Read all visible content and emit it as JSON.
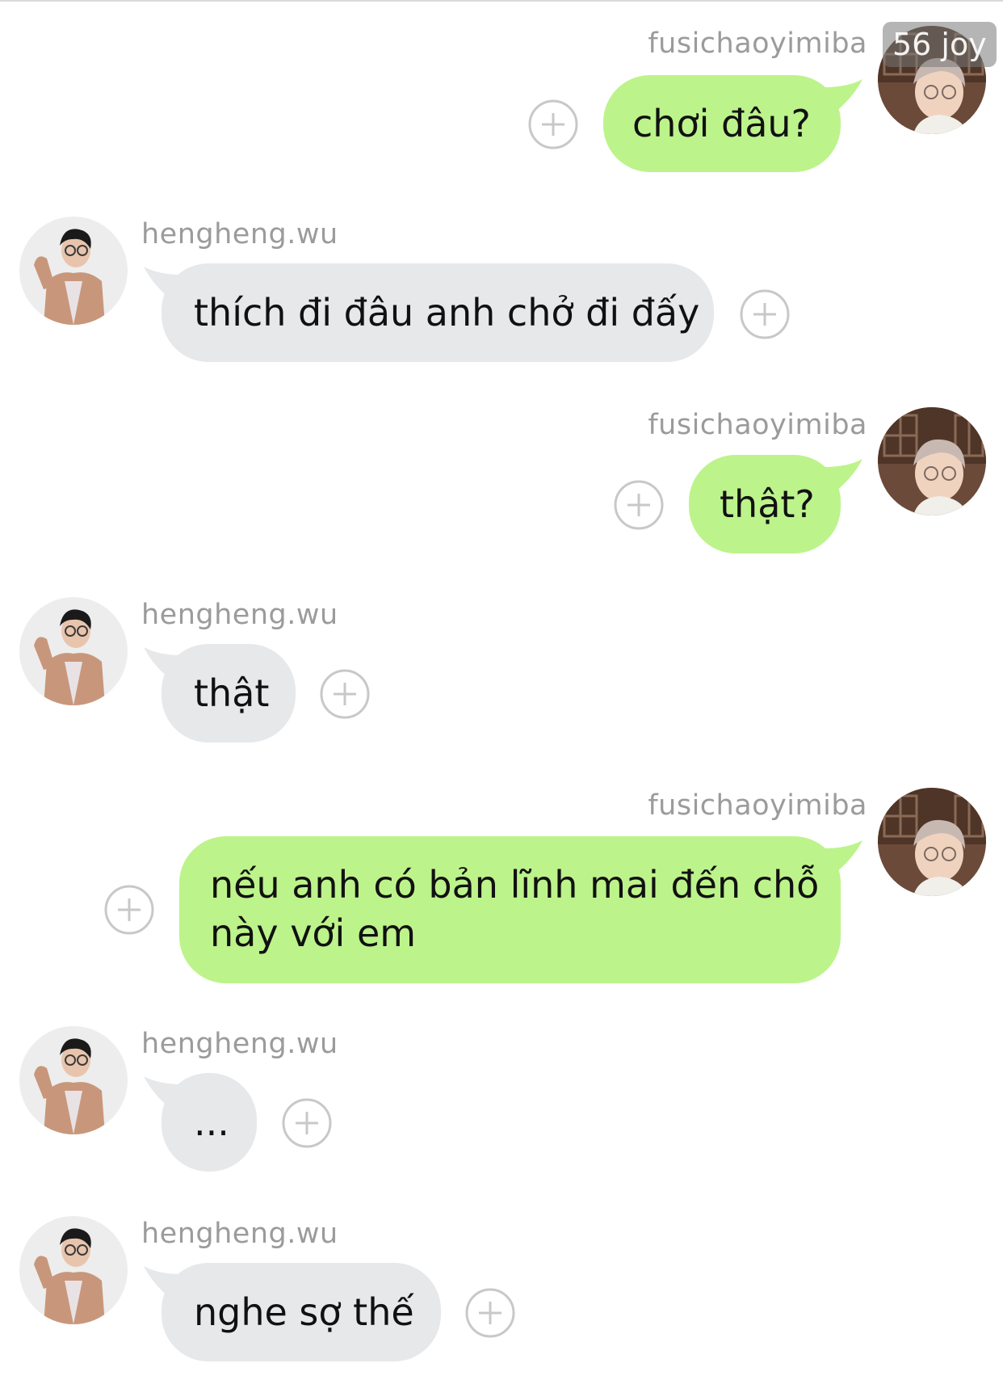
{
  "watermark": "56 joy",
  "messages": [
    {
      "sender": "fusichaoyimiba",
      "text": "chơi đâu?",
      "side": "out"
    },
    {
      "sender": "hengheng.wu",
      "text": "thích đi đâu anh chở đi đấy",
      "side": "in"
    },
    {
      "sender": "fusichaoyimiba",
      "text": "thật?",
      "side": "out"
    },
    {
      "sender": "hengheng.wu",
      "text": "thật",
      "side": "in"
    },
    {
      "sender": "fusichaoyimiba",
      "text_line1": "nếu anh có bản lĩnh mai đến chỗ",
      "text_line2": "này với em",
      "side": "out"
    },
    {
      "sender": "hengheng.wu",
      "text": "...",
      "side": "in"
    },
    {
      "sender": "hengheng.wu",
      "text": "nghe sợ thế",
      "side": "in"
    }
  ],
  "colors": {
    "outgoing_bubble": "#bdf38b",
    "incoming_bubble": "#e6e8ea",
    "sender_name": "#9b9b9b",
    "add_icon": "#c8c8c8"
  },
  "icons": {
    "add": "plus-circle-icon",
    "avatar_out": "avatar-fusichaoyimiba",
    "avatar_in": "avatar-hengheng-wu"
  }
}
